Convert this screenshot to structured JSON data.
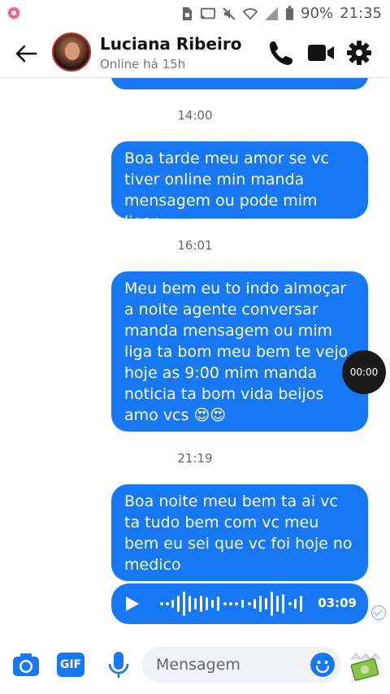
{
  "status_bar": {
    "battery": "90%",
    "time": "21:35"
  },
  "header": {
    "contact_name": "Luciana Ribeiro",
    "contact_status": "Online há 15h"
  },
  "messages": [
    {
      "type": "timestamp",
      "text": "14:00"
    },
    {
      "type": "sent",
      "text": "Boa tarde meu amor se vc tiver online min manda mensagem ou pode mim ligar"
    },
    {
      "type": "timestamp",
      "text": "16:01"
    },
    {
      "type": "sent",
      "text": "Meu bem eu to indo almoçar a noite agente conversar manda mensagem ou mim liga ta bom meu bem te vejo hoje as 9:00 mim manda noticia ta bom vida beijos amo vcs 😍😍"
    },
    {
      "type": "timestamp",
      "text": "21:19"
    },
    {
      "type": "sent",
      "text": "Boa noite meu bem ta ai vc ta tudo bem com vc meu bem eu sei que vc foi hoje no medico"
    },
    {
      "type": "audio",
      "duration": "03:09"
    }
  ],
  "overlay_timer": "00:00",
  "composer": {
    "placeholder": "Mensagem",
    "gif_label": "GIF"
  },
  "colors": {
    "accent": "#1877f2",
    "bubble_text": "#ffffff"
  }
}
